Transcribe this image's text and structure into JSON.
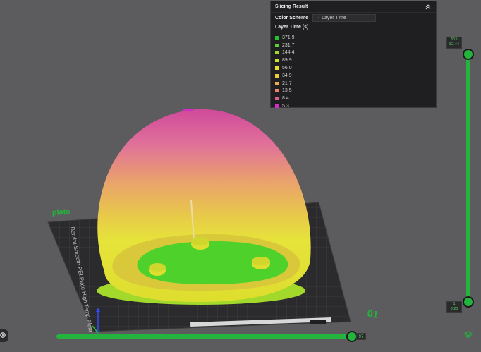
{
  "panel": {
    "title": "Slicing Result",
    "color_scheme_label": "Color Scheme",
    "color_scheme_value": "Layer Time",
    "legend_title": "Layer Time (s)",
    "legend": [
      {
        "label": "371.9",
        "color": "#22c32e"
      },
      {
        "label": "231.7",
        "color": "#5ccf2c"
      },
      {
        "label": "144.4",
        "color": "#9fd82a"
      },
      {
        "label": "89.9",
        "color": "#cfe12b"
      },
      {
        "label": "56.0",
        "color": "#e6df29"
      },
      {
        "label": "34.9",
        "color": "#eacb39"
      },
      {
        "label": "21.7",
        "color": "#ecaa50"
      },
      {
        "label": "13.5",
        "color": "#e8866a"
      },
      {
        "label": "8.4",
        "color": "#dd5d90"
      },
      {
        "label": "5.3",
        "color": "#cf2fc6"
      }
    ]
  },
  "layer_slider": {
    "top_layer": "515",
    "top_height": "82.44",
    "bottom_layer": "1",
    "bottom_height": "0.20"
  },
  "move_slider": {
    "value": "97"
  },
  "plate": {
    "label": "plate",
    "number": "01",
    "texture_label": "Bambu Smooth PEI Plate High Temp Plate"
  }
}
